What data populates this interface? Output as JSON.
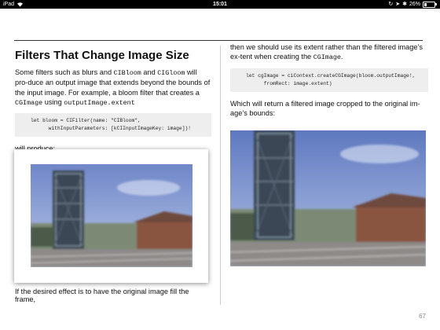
{
  "status_bar": {
    "device": "iPad",
    "time": "15:01",
    "battery_percent": "26%",
    "battery_level": 0.26,
    "icons": [
      "wifi-icon",
      "lock-rotation-icon",
      "location-icon",
      "bluetooth-icon",
      "battery-icon"
    ]
  },
  "left_column": {
    "heading": "Filters That Change Image Size",
    "p1_a": "Some filters such as blurs and ",
    "p1_code1": "CIBloom",
    "p1_b": " and ",
    "p1_code2": "CIGloom",
    "p1_c": " will pro-duce an output image that extends beyond the bounds of the input image. For example, a bloom filter that creates a ",
    "p1_code3": "CGImage",
    "p1_d": " using ",
    "p1_code4": "outputImage.extent",
    "code1": "let bloom = CIFilter(name: \"CIBloom\",\n      withInputParameters: [kCIInputImageKey: image])!",
    "will_produce": "will produce:",
    "caption": "If the desired effect is to have the original image fill the frame,"
  },
  "right_column": {
    "p1_a": "then we should use its extent rather than the filtered image’s ex-tent when creating the ",
    "p1_code": "CGImage",
    "p1_b": ".",
    "code2": "let cgImage = ciContext.createCGImage(bloom.outputImage!,\n      fromRect: image.extent)",
    "p2": "Which will return a filtered image cropped to the original im-age’s bounds:"
  },
  "page_number": "67"
}
